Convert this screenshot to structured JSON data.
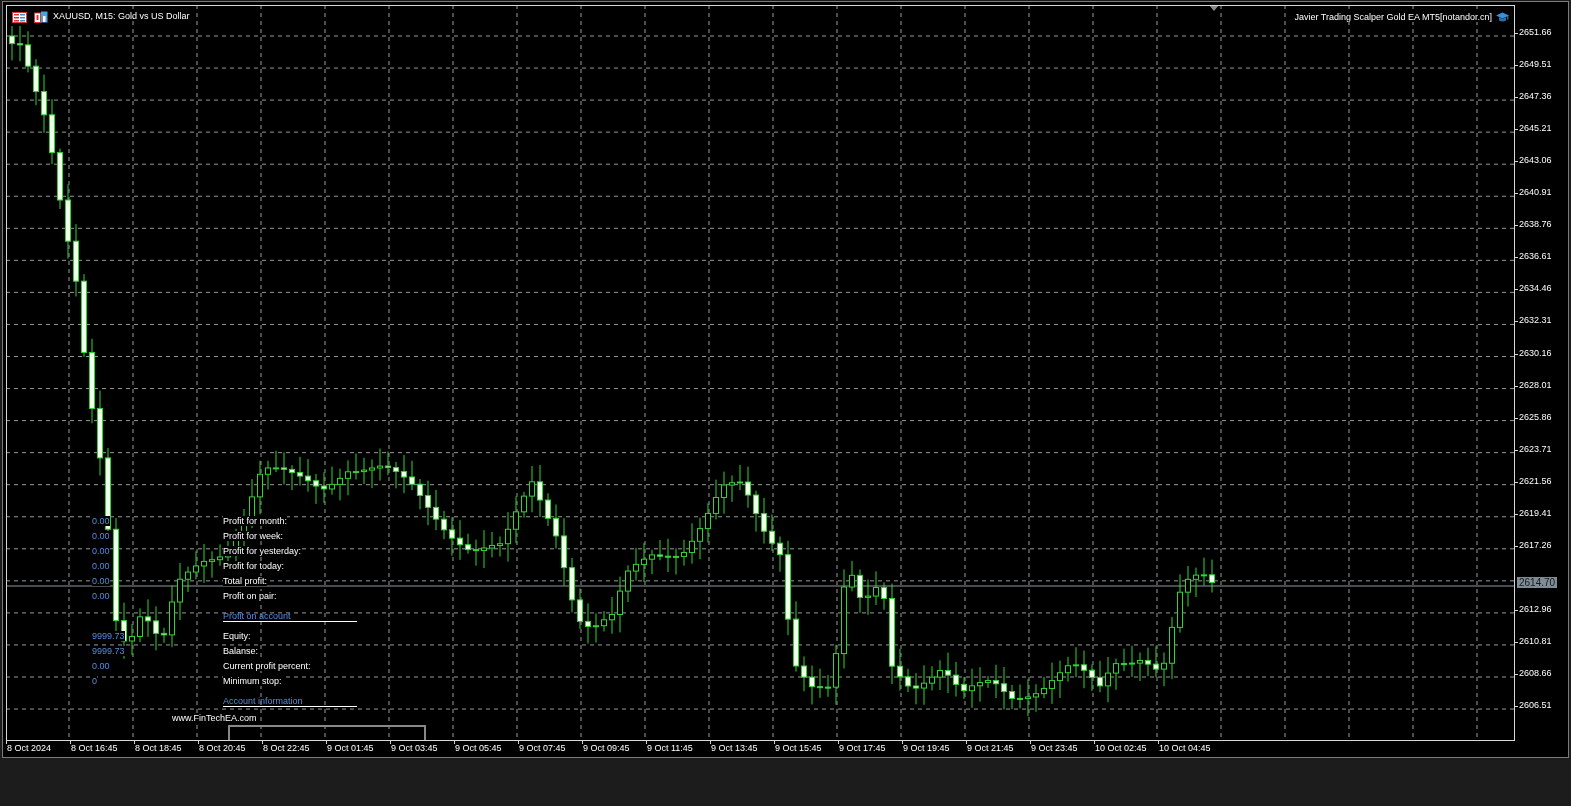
{
  "chart": {
    "title": "XAUUSD, M15:  Gold vs US Dollar",
    "expert": "Javier Trading Scalper Gold EA MT5[notandor.cn]",
    "current_price": "2614.70",
    "price_axis": [
      "2651.66",
      "2649.51",
      "2647.36",
      "2645.21",
      "2643.06",
      "2640.91",
      "2638.76",
      "2636.61",
      "2634.46",
      "2632.31",
      "2630.16",
      "2628.01",
      "2625.86",
      "2623.71",
      "2621.56",
      "2619.41",
      "2617.26",
      "2612.96",
      "2610.81",
      "2608.66",
      "2606.51"
    ],
    "time_axis": [
      "8 Oct 2024",
      "8 Oct 16:45",
      "8 Oct 18:45",
      "8 Oct 20:45",
      "8 Oct 22:45",
      "9 Oct 01:45",
      "9 Oct 03:45",
      "9 Oct 05:45",
      "9 Oct 07:45",
      "9 Oct 09:45",
      "9 Oct 11:45",
      "9 Oct 13:45",
      "9 Oct 15:45",
      "9 Oct 17:45",
      "9 Oct 19:45",
      "9 Oct 21:45",
      "9 Oct 23:45",
      "10 Oct 02:45",
      "10 Oct 04:45"
    ]
  },
  "info_panel": {
    "items": [
      {
        "kind": "row",
        "label": "Profit for month:",
        "value": "0.00"
      },
      {
        "kind": "row",
        "label": "Profit for week:",
        "value": "0.00"
      },
      {
        "kind": "row",
        "label": "Profit for yesterday:",
        "value": "0.00"
      },
      {
        "kind": "row",
        "label": "Profit for today:",
        "value": "0.00"
      },
      {
        "kind": "row",
        "label": "Total profit:",
        "value": "0.00"
      },
      {
        "kind": "row",
        "label": "Profit on pair:",
        "value": "0.00"
      },
      {
        "kind": "heading",
        "label": "Profit on account"
      },
      {
        "kind": "row",
        "label": "Equity:",
        "value": "9999.73"
      },
      {
        "kind": "row",
        "label": "Balanse:",
        "value": "9999.73"
      },
      {
        "kind": "row",
        "label": "Current profit percent:",
        "value": "0.00"
      },
      {
        "kind": "row",
        "label": "Minimum stop:",
        "value": "0"
      },
      {
        "kind": "heading",
        "label": "Account information"
      }
    ],
    "footer": "www.FinTechEA.com"
  }
}
